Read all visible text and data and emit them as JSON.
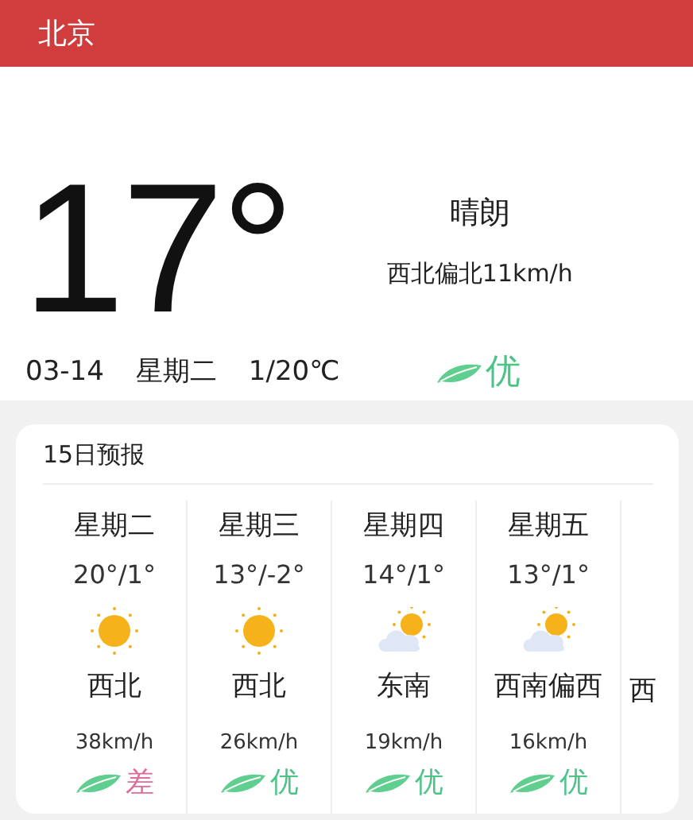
{
  "header": {
    "title": "北京"
  },
  "current": {
    "temperature": "17°",
    "condition": "晴朗",
    "wind": "西北偏北11km/h",
    "date": "03-14",
    "weekday": "星期二",
    "range": "1/20℃",
    "air": {
      "label": "优",
      "color": "#4cc488"
    }
  },
  "forecast": {
    "title": "15日预报",
    "days": [
      {
        "weekday": "星期二",
        "temps": "20°/1°",
        "kind": "sunny",
        "wind_dir": "西北",
        "wind_speed": "38km/h",
        "air": {
          "label": "差",
          "color": "#e06a9a"
        }
      },
      {
        "weekday": "星期三",
        "temps": "13°/-2°",
        "kind": "sunny",
        "wind_dir": "西北",
        "wind_speed": "26km/h",
        "air": {
          "label": "优",
          "color": "#4cc488"
        }
      },
      {
        "weekday": "星期四",
        "temps": "14°/1°",
        "kind": "partly_cloudy",
        "wind_dir": "东南",
        "wind_speed": "19km/h",
        "air": {
          "label": "优",
          "color": "#4cc488"
        }
      },
      {
        "weekday": "星期五",
        "temps": "13°/1°",
        "kind": "partly_cloudy",
        "wind_dir": "西南偏西",
        "wind_speed": "16km/h",
        "air": {
          "label": "优",
          "color": "#4cc488"
        }
      },
      {
        "wind_dir": "西"
      }
    ]
  }
}
